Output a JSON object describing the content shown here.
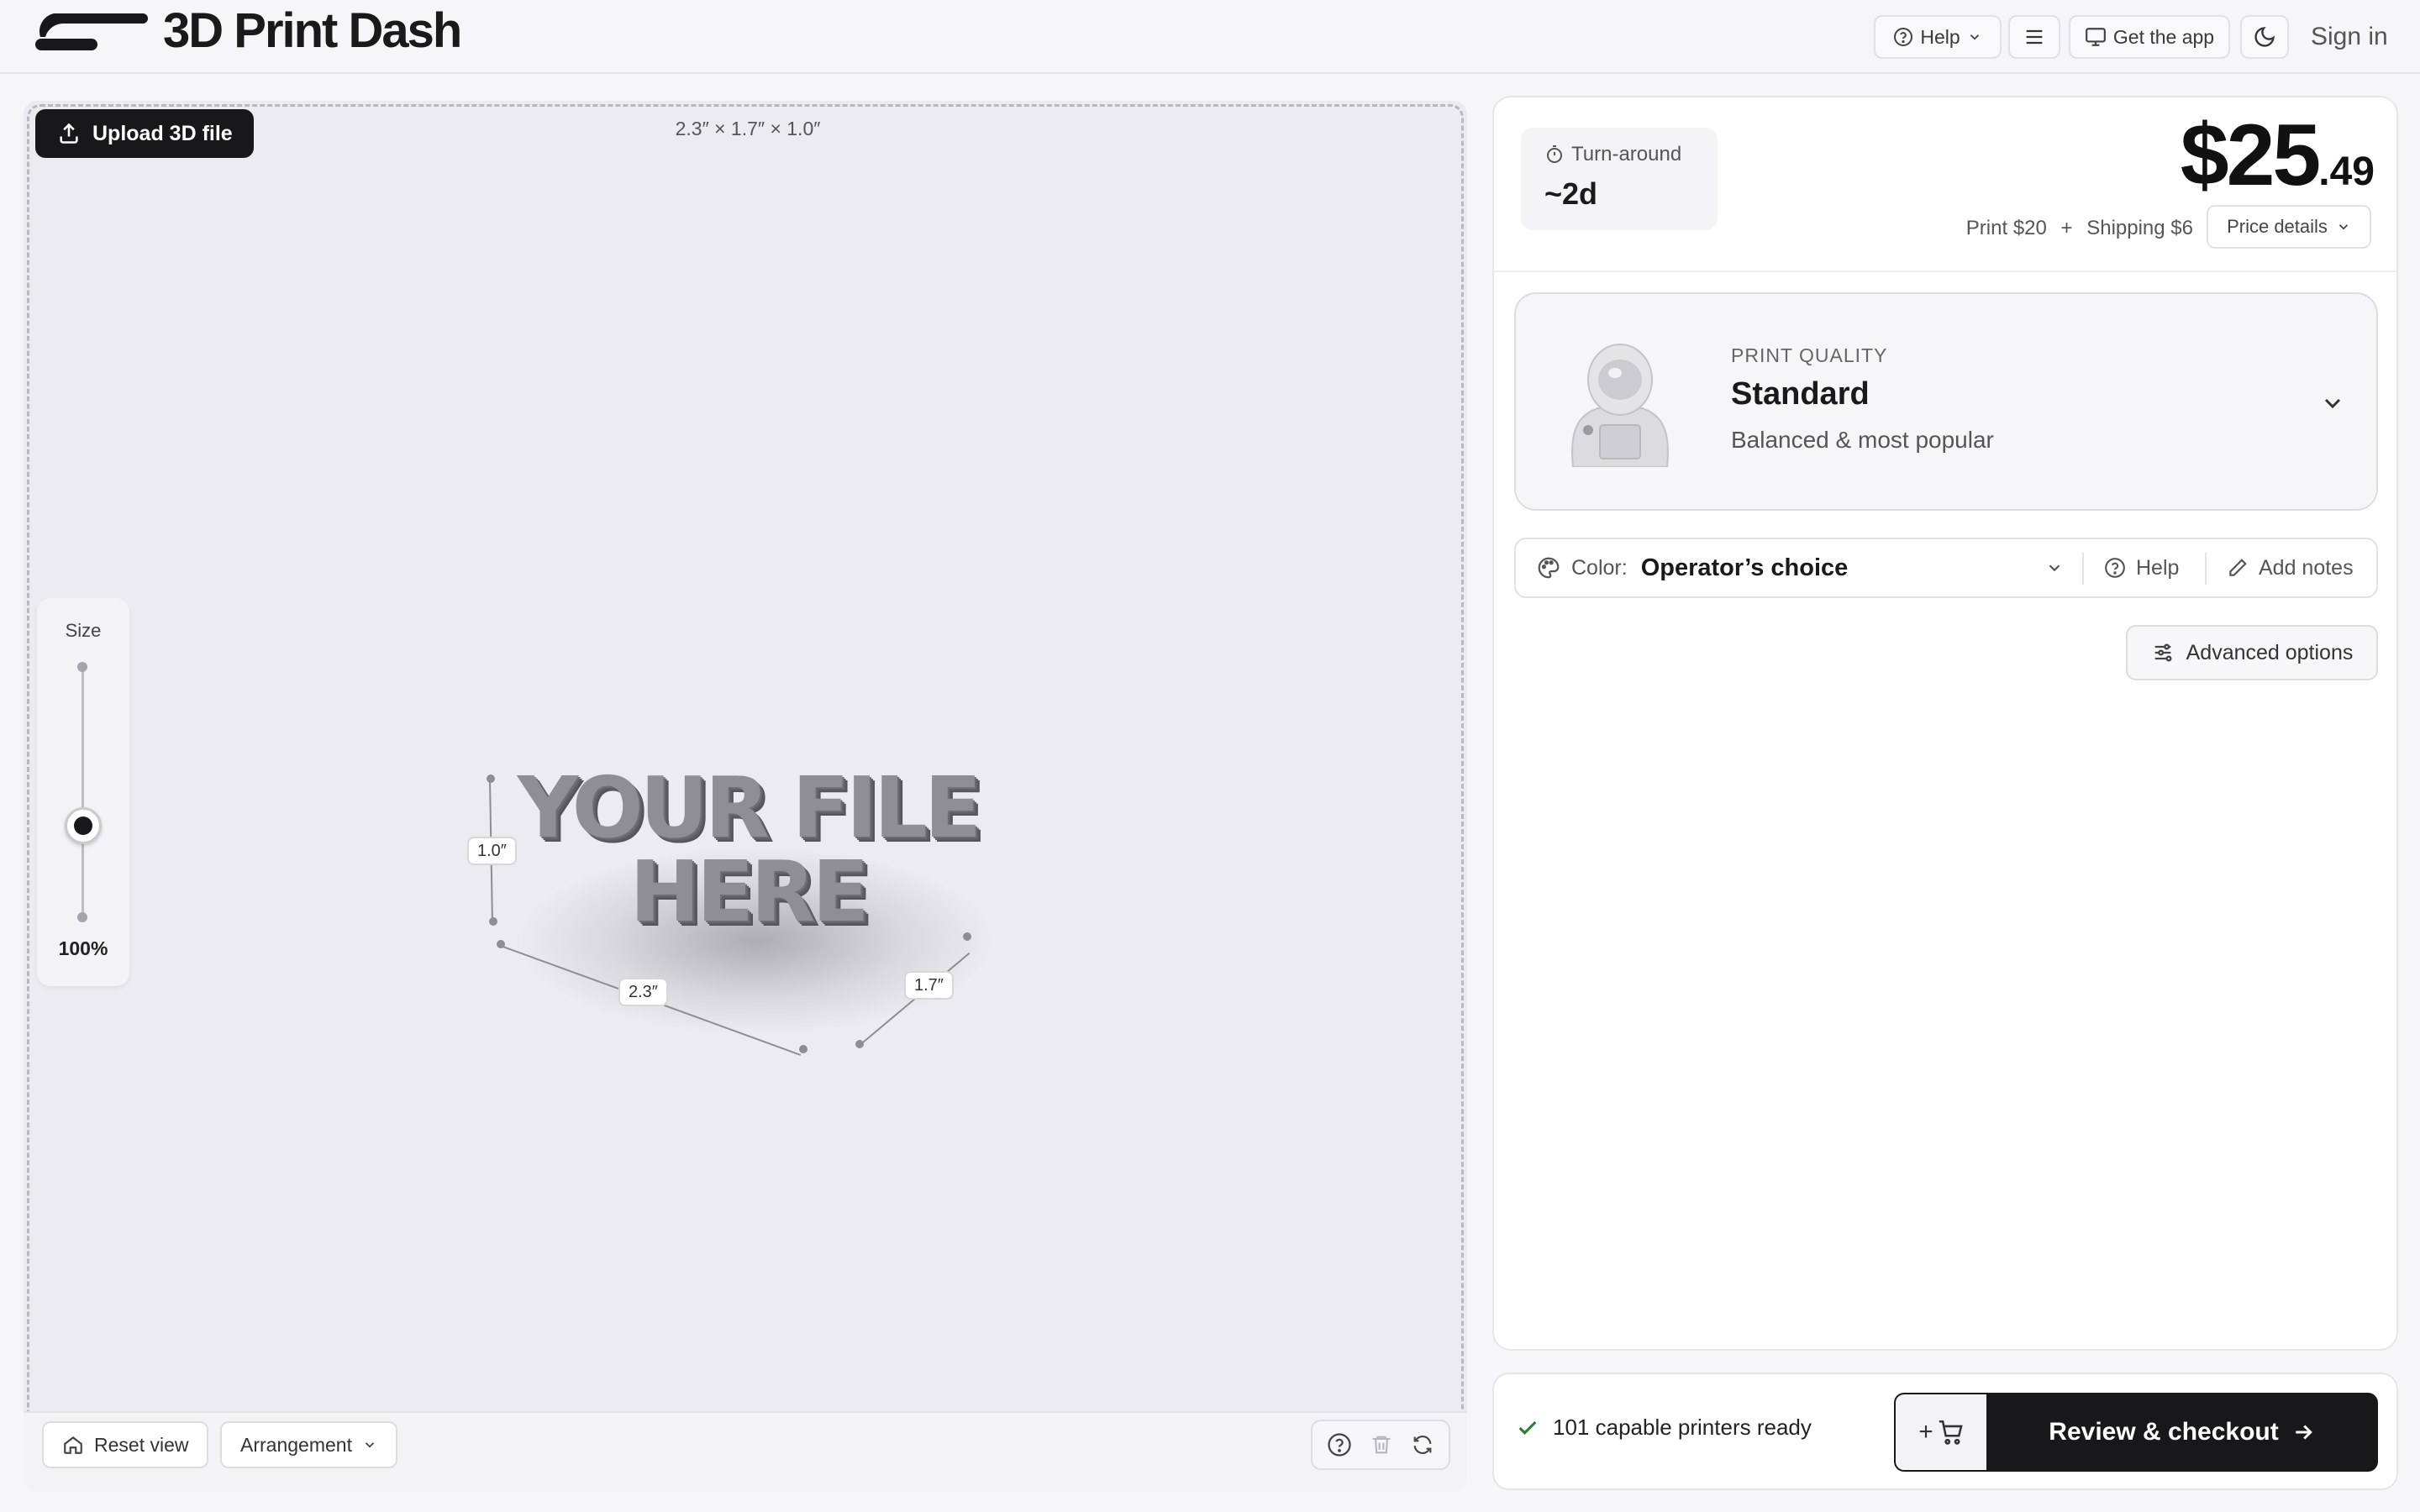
{
  "header": {
    "brand": "3D Print Dash",
    "help_label": "Help",
    "get_app_label": "Get the app",
    "sign_in_label": "Sign in"
  },
  "viewer": {
    "upload_label": "Upload 3D file",
    "dimensions": "2.3″ × 1.7″ × 1.0″",
    "size_label": "Size",
    "size_percent": "100%",
    "size_slider_value": 1.0,
    "model_line1": "YOUR FILE",
    "model_line2": "HERE",
    "dim_height": "1.0″",
    "dim_width": "2.3″",
    "dim_depth": "1.7″",
    "reset_view_label": "Reset view",
    "arrangement_label": "Arrangement"
  },
  "quote": {
    "turnaround_label": "Turn-around",
    "turnaround_value": "~2d",
    "price_dollars": "$25",
    "price_cents": ".49",
    "print_cost": "Print $20",
    "plus": "+",
    "shipping_cost": "Shipping $6",
    "price_details_label": "Price details"
  },
  "print_quality": {
    "caption": "PRINT QUALITY",
    "title": "Standard",
    "subtitle": "Balanced & most popular"
  },
  "options": {
    "color_label": "Color:",
    "color_value": "Operator’s choice",
    "help_label": "Help",
    "add_notes_label": "Add notes",
    "advanced_label": "Advanced options"
  },
  "footer": {
    "printers_ready": "101 capable printers ready",
    "cart_plus": "+",
    "checkout_label": "Review & checkout"
  },
  "colors": {
    "primary": "#18181b",
    "background": "#f6f6f8",
    "viewer_bg": "#ececf0",
    "success": "#2e7d32"
  },
  "icons": [
    "upload-icon",
    "help-circle-icon",
    "chevron-down-icon",
    "menu-icon",
    "monitor-icon",
    "moon-icon",
    "home-icon",
    "trash-icon",
    "refresh-icon",
    "timer-icon",
    "palette-icon",
    "pencil-icon",
    "sliders-icon",
    "check-icon",
    "cart-icon",
    "arrow-right-icon"
  ]
}
